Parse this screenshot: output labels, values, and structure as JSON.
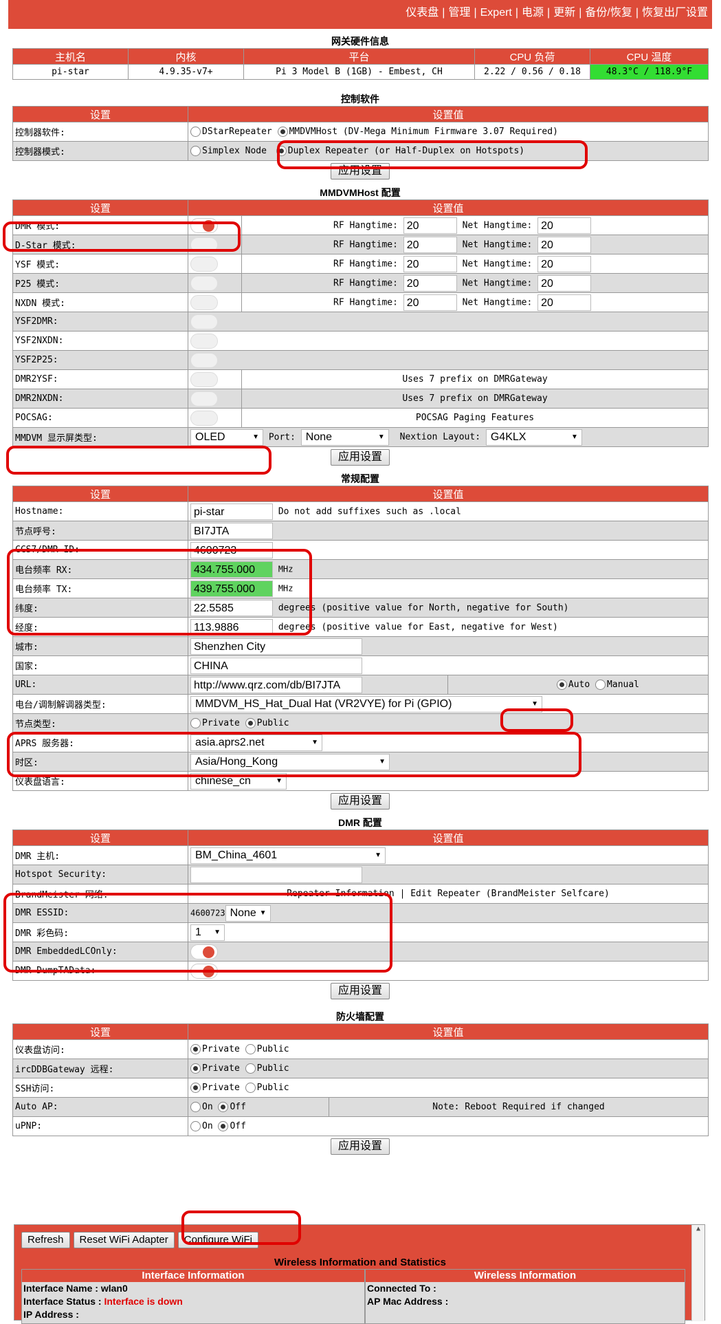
{
  "nav": [
    "仪表盘",
    "管理",
    "Expert",
    "电源",
    "更新",
    "备份/恢复",
    "恢复出厂设置"
  ],
  "hw": {
    "title": "网关硬件信息",
    "headers": [
      "主机名",
      "内核",
      "平台",
      "CPU 负荷",
      "CPU 温度"
    ],
    "values": [
      "pi-star",
      "4.9.35-v7+",
      "Pi 3 Model B (1GB) - Embest, CH",
      "2.22 / 0.56 / 0.18",
      "48.3°C / 118.9°F"
    ]
  },
  "ctrl": {
    "title": "控制软件",
    "h1": "设置",
    "h2": "设置值",
    "row1_label": "控制器软件:",
    "row1_opt1": "DStarRepeater",
    "row1_opt2": "MMDVMHost (DV-Mega Minimum Firmware 3.07 Required)",
    "row2_label": "控制器模式:",
    "row2_opt1": "Simplex Node",
    "row2_opt2": "Duplex Repeater (or Half-Duplex on Hotspots)"
  },
  "apply": "应用设置",
  "mmdvm": {
    "title": "MMDVMHost 配置",
    "h1": "设置",
    "h2": "设置值",
    "rf": "RF Hangtime:",
    "net": "Net Hangtime:",
    "modes": [
      {
        "label": "DMR 模式:",
        "rf": "20",
        "net": "20"
      },
      {
        "label": "D-Star 模式:",
        "rf": "20",
        "net": "20"
      },
      {
        "label": "YSF 模式:",
        "rf": "20",
        "net": "20"
      },
      {
        "label": "P25 模式:",
        "rf": "20",
        "net": "20"
      },
      {
        "label": "NXDN 模式:",
        "rf": "20",
        "net": "20"
      }
    ],
    "ysf2dmr": "YSF2DMR:",
    "ysf2nxdn": "YSF2NXDN:",
    "ysf2p25": "YSF2P25:",
    "dmr2ysf": "DMR2YSF:",
    "dmr2nxdn": "DMR2NXDN:",
    "pocsag": "POCSAG:",
    "prefix_note": "Uses 7 prefix on DMRGateway",
    "pocsag_note": "POCSAG Paging Features",
    "display_label": "MMDVM 显示屏类型:",
    "display_value": "OLED",
    "port_label": "Port:",
    "port_value": "None",
    "nextion_label": "Nextion Layout:",
    "nextion_value": "G4KLX"
  },
  "general": {
    "title": "常规配置",
    "h1": "设置",
    "h2": "设置值",
    "hostname_label": "Hostname:",
    "hostname": "pi-star",
    "hostname_note": "Do not add suffixes such as .local",
    "callsign_label": "节点呼号:",
    "callsign": "BI7JTA",
    "dmrid_label": "CCS7/DMR ID:",
    "dmrid": "4600723",
    "rx_label": "电台频率 RX:",
    "rx": "434.755.000",
    "tx_label": "电台频率 TX:",
    "tx": "439.755.000",
    "mhz": "MHz",
    "lat_label": "纬度:",
    "lat": "22.5585",
    "lat_note": "degrees (positive value for North, negative for South)",
    "lon_label": "经度:",
    "lon": "113.9886",
    "lon_note": "degrees (positive value for East, negative for West)",
    "city_label": "城市:",
    "city": "Shenzhen City",
    "country_label": "国家:",
    "country": "CHINA",
    "url_label": "URL:",
    "url": "http://www.qrz.com/db/BI7JTA",
    "url_auto": "Auto",
    "url_manual": "Manual",
    "modem_label": "电台/调制解调器类型:",
    "modem": "MMDVM_HS_Hat_Dual Hat (VR2VYE) for Pi (GPIO)",
    "nodetype_label": "节点类型:",
    "node_private": "Private",
    "node_public": "Public",
    "aprs_label": "APRS 服务器:",
    "aprs": "asia.aprs2.net",
    "tz_label": "时区:",
    "tz": "Asia/Hong_Kong",
    "lang_label": "仪表盘语言:",
    "lang": "chinese_cn"
  },
  "dmr": {
    "title": "DMR 配置",
    "h1": "设置",
    "h2": "设置值",
    "master_label": "DMR 主机:",
    "master": "BM_China_4601",
    "security_label": "Hotspot Security:",
    "bm_label": "BrandMeister 网络:",
    "bm_info": "Repeater Information",
    "bm_edit": "| Edit Repeater (BrandMeister Selfcare)",
    "essid_label": "DMR ESSID:",
    "essid_prefix": "4600723",
    "essid": "None",
    "cc_label": "DMR 彩色码:",
    "cc": "1",
    "elc_label": "DMR EmbeddedLCOnly:",
    "dump_label": "DMR DumpTAData:"
  },
  "fw": {
    "title": "防火墙配置",
    "h1": "设置",
    "h2": "设置值",
    "private": "Private",
    "public": "Public",
    "on": "On",
    "off": "Off",
    "dash_label": "仪表盘访问:",
    "irc_label": "ircDDBGateway 远程:",
    "ssh_label": "SSH访问:",
    "autoap_label": "Auto AP:",
    "autoap_note": "Note: Reboot Required if changed",
    "upnp_label": "uPNP:"
  },
  "wifi": {
    "refresh": "Refresh",
    "reset": "Reset WiFi Adapter",
    "configure": "Configure WiFi",
    "title": "Wireless Information and Statistics",
    "iface_header": "Interface Information",
    "wl_header": "Wireless Information",
    "iface_name_label": "Interface Name :",
    "iface_name": "wlan0",
    "iface_status_label": "Interface Status :",
    "iface_status": "Interface is down",
    "ip_label": "IP Address :",
    "connected_label": "Connected To :",
    "ap_mac_label": "AP Mac Address :"
  },
  "colors": {
    "accent": "#dd4b39",
    "temp_bg": "#33dd33",
    "freq_bg": "#5fd35f",
    "highlight": "#e00000"
  }
}
